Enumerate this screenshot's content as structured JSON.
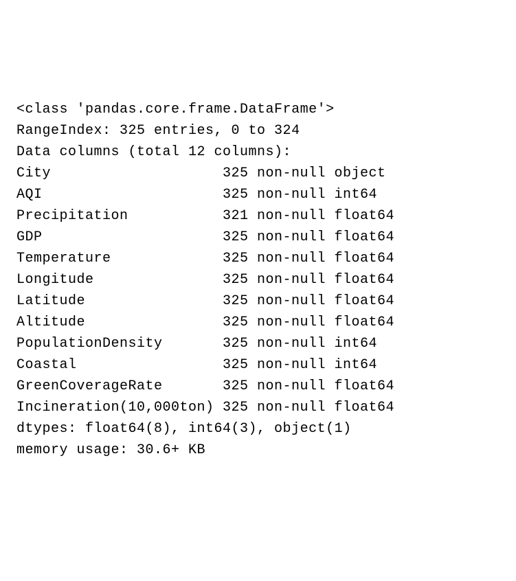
{
  "header": {
    "class_line": "<class 'pandas.core.frame.DataFrame'>",
    "rangeindex_line": "RangeIndex: 325 entries, 0 to 324",
    "datacols_line": "Data columns (total 12 columns):"
  },
  "columns": [
    {
      "name": "City",
      "info": "325 non-null object"
    },
    {
      "name": "AQI",
      "info": "325 non-null int64"
    },
    {
      "name": "Precipitation",
      "info": "321 non-null float64"
    },
    {
      "name": "GDP",
      "info": "325 non-null float64"
    },
    {
      "name": "Temperature",
      "info": "325 non-null float64"
    },
    {
      "name": "Longitude",
      "info": "325 non-null float64"
    },
    {
      "name": "Latitude",
      "info": "325 non-null float64"
    },
    {
      "name": "Altitude",
      "info": "325 non-null float64"
    },
    {
      "name": "PopulationDensity",
      "info": "325 non-null int64"
    },
    {
      "name": "Coastal",
      "info": "325 non-null int64"
    },
    {
      "name": "GreenCoverageRate",
      "info": "325 non-null float64"
    },
    {
      "name": "Incineration(10,000ton)",
      "info": "325 non-null float64"
    }
  ],
  "footer": {
    "dtypes_line": "dtypes: float64(8), int64(3), object(1)",
    "memory_line": "memory usage: 30.6+ KB"
  }
}
